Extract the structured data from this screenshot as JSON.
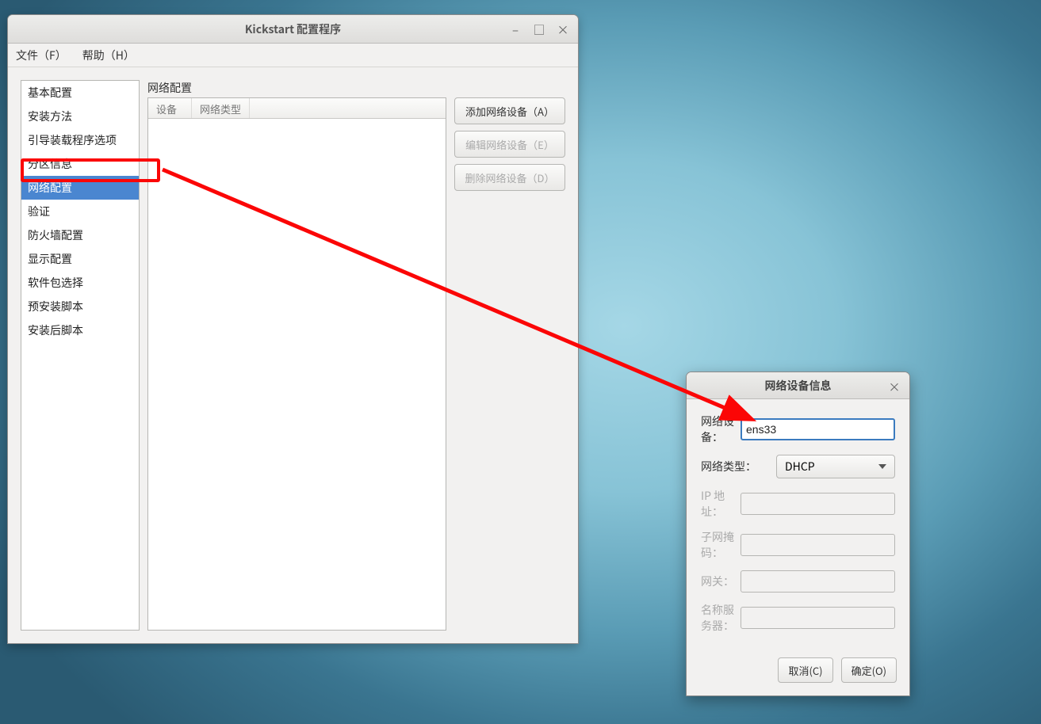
{
  "window": {
    "title": "Kickstart 配置程序"
  },
  "menu": {
    "file": "文件（F）",
    "help": "帮助（H）"
  },
  "sidebar": {
    "items": [
      "基本配置",
      "安装方法",
      "引导装载程序选项",
      "分区信息",
      "网络配置",
      "验证",
      "防火墙配置",
      "显示配置",
      "软件包选择",
      "预安装脚本",
      "安装后脚本"
    ],
    "selected_index": 4
  },
  "section": {
    "title": "网络配置",
    "col_device": "设备",
    "col_type": "网络类型",
    "buttons": {
      "add": "添加网络设备（A）",
      "edit": "编辑网络设备（E）",
      "delete": "删除网络设备（D）"
    }
  },
  "dialog": {
    "title": "网络设备信息",
    "labels": {
      "device": "网络设备：",
      "type": "网络类型：",
      "ip": "IP 地址：",
      "mask": "子网掩码：",
      "gateway": "网关：",
      "dns": "名称服务器："
    },
    "values": {
      "device": "ens33",
      "type": "DHCP"
    },
    "buttons": {
      "cancel": "取消(C)",
      "ok": "确定(O)"
    }
  },
  "annotation": {
    "color": "#fb0606"
  }
}
